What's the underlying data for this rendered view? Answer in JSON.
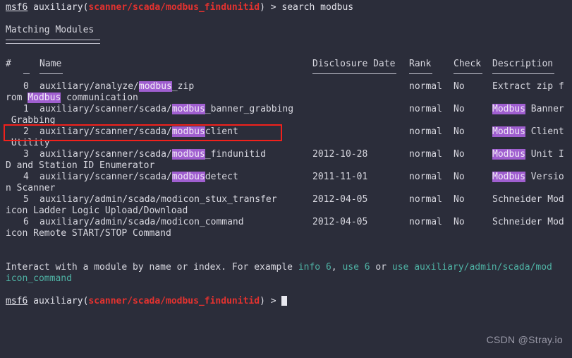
{
  "terminal": {
    "background": "#2b2d3a",
    "foreground": "#d8d8e0",
    "accent_red": "#e3322f",
    "accent_teal": "#4fb3a5",
    "highlight_bg": "#a05fd0",
    "annotation_red": "#f1211c"
  },
  "prompt_top": {
    "shell": "msf6",
    "context_prefix": "auxiliary(",
    "context_module": "scanner/scada/modbus_findunitid",
    "context_suffix": ") > ",
    "command": "search modbus"
  },
  "heading": "Matching Modules",
  "table": {
    "headers": {
      "index": "#",
      "name": "Name",
      "disclosure_date": "Disclosure Date",
      "rank": "Rank",
      "check": "Check",
      "description": "Description"
    },
    "separators": {
      "index": "-",
      "name": "----",
      "disclosure_date": "---------------",
      "rank": "----",
      "check": "-----",
      "description": "-----------"
    },
    "rows": [
      {
        "index": "0",
        "name_pre": "auxiliary/analyze/",
        "name_hl": "modbus",
        "name_post": "_zip",
        "disclosure_date": "",
        "rank": "normal",
        "check": "No",
        "desc_line1_pre": "",
        "desc_line1_hl": "",
        "desc_line1_post": "Extract zip f",
        "desc_line2_pre": "rom ",
        "desc_line2_hl": "Modbus",
        "desc_line2_post": " communication"
      },
      {
        "index": "1",
        "name_pre": "auxiliary/scanner/scada/",
        "name_hl": "modbus",
        "name_post": "_banner_grabbing",
        "disclosure_date": "",
        "rank": "normal",
        "check": "No",
        "desc_line1_pre": "",
        "desc_line1_hl": "Modbus",
        "desc_line1_post": " Banner",
        "desc_line2_pre": " Grabbing",
        "desc_line2_hl": "",
        "desc_line2_post": ""
      },
      {
        "index": "2",
        "name_pre": "auxiliary/scanner/scada/",
        "name_hl": "modbus",
        "name_post": "client",
        "disclosure_date": "",
        "rank": "normal",
        "check": "No",
        "desc_line1_pre": "",
        "desc_line1_hl": "Modbus",
        "desc_line1_post": " Client",
        "desc_line2_pre": " Utility",
        "desc_line2_hl": "",
        "desc_line2_post": ""
      },
      {
        "index": "3",
        "name_pre": "auxiliary/scanner/scada/",
        "name_hl": "modbus",
        "name_post": "_findunitid",
        "disclosure_date": "2012-10-28",
        "rank": "normal",
        "check": "No",
        "desc_line1_pre": "",
        "desc_line1_hl": "Modbus",
        "desc_line1_post": " Unit I",
        "desc_line2_pre": "D and Station ID Enumerator",
        "desc_line2_hl": "",
        "desc_line2_post": ""
      },
      {
        "index": "4",
        "name_pre": "auxiliary/scanner/scada/",
        "name_hl": "modbus",
        "name_post": "detect",
        "disclosure_date": "2011-11-01",
        "rank": "normal",
        "check": "No",
        "desc_line1_pre": "",
        "desc_line1_hl": "Modbus",
        "desc_line1_post": " Versio",
        "desc_line2_pre": "n Scanner",
        "desc_line2_hl": "",
        "desc_line2_post": ""
      },
      {
        "index": "5",
        "name_pre": "auxiliary/admin/scada/modicon_stux_transfer",
        "name_hl": "",
        "name_post": "",
        "disclosure_date": "2012-04-05",
        "rank": "normal",
        "check": "No",
        "desc_line1_pre": "Schneider Mod",
        "desc_line1_hl": "",
        "desc_line1_post": "",
        "desc_line2_pre": "icon Ladder Logic Upload/Download",
        "desc_line2_hl": "",
        "desc_line2_post": ""
      },
      {
        "index": "6",
        "name_pre": "auxiliary/admin/scada/modicon_command",
        "name_hl": "",
        "name_post": "",
        "disclosure_date": "2012-04-05",
        "rank": "normal",
        "check": "No",
        "desc_line1_pre": "Schneider Mod",
        "desc_line1_hl": "",
        "desc_line1_post": "",
        "desc_line2_pre": "icon Remote START/STOP Command",
        "desc_line2_hl": "",
        "desc_line2_post": ""
      }
    ]
  },
  "hint": {
    "text_a": "Interact with a module by name or index. For example ",
    "cmd_1": "info 6",
    "text_b": ", ",
    "cmd_2": "use 6",
    "text_c": " or ",
    "cmd_3": "use auxiliary/admin/scada/mod",
    "cmd_3_wrap": "icon_command"
  },
  "prompt_bottom": {
    "shell": "msf6",
    "context_prefix": "auxiliary(",
    "context_module": "scanner/scada/modbus_findunitid",
    "context_suffix": ") > "
  },
  "watermark": "CSDN @Stray.io",
  "annotation": {
    "target_row_index": "2",
    "shape": "red-rectangle"
  }
}
